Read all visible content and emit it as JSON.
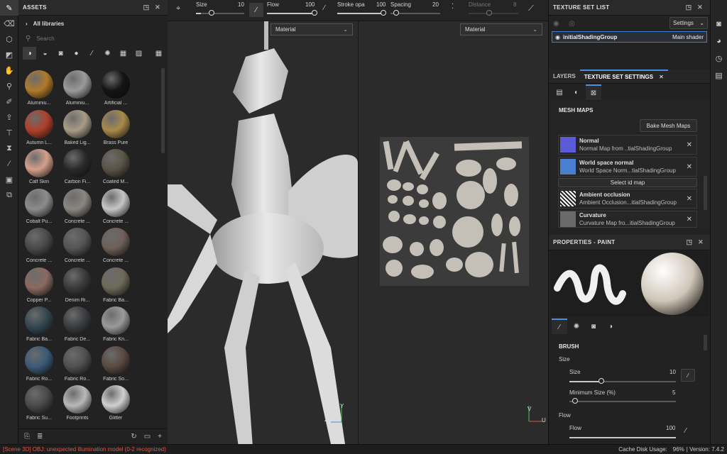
{
  "tools": {
    "items": [
      "brush-icon",
      "eraser-icon",
      "projection-icon",
      "polygon-fill-icon",
      "smudge-icon",
      "clone-icon",
      "color-picker-icon",
      "bake-icon",
      "text-icon",
      "geometry-mask-icon",
      "eyedropper-icon",
      "screenshot-icon",
      "layers-3d-icon"
    ]
  },
  "assets": {
    "title": "ASSETS",
    "library": "All libraries",
    "search_placeholder": "Search",
    "materials": [
      {
        "name": "Aluminiu...",
        "color": "#b07a2a"
      },
      {
        "name": "Aluminiu...",
        "color": "#9a9a9a"
      },
      {
        "name": "Artificial ...",
        "color": "#141414"
      },
      {
        "name": "Autumn L...",
        "color": "#b0402a"
      },
      {
        "name": "Baked Lig...",
        "color": "#a89c88"
      },
      {
        "name": "Brass Pure",
        "color": "#a88a4a"
      },
      {
        "name": "Calf Skin",
        "color": "#d4a08a"
      },
      {
        "name": "Carbon Fi...",
        "color": "#2a2a2a"
      },
      {
        "name": "Coated M...",
        "color": "#5a5446"
      },
      {
        "name": "Cobalt Pu...",
        "color": "#8c8c8c"
      },
      {
        "name": "Concrete ...",
        "color": "#8a8680"
      },
      {
        "name": "Concrete ...",
        "color": "#c6c6c6"
      },
      {
        "name": "Concrete ...",
        "color": "#4a4a4a"
      },
      {
        "name": "Concrete ...",
        "color": "#555555"
      },
      {
        "name": "Concrete ...",
        "color": "#6e6058"
      },
      {
        "name": "Copper P...",
        "color": "#8a6a60"
      },
      {
        "name": "Denim Ri...",
        "color": "#3a3a3a"
      },
      {
        "name": "Fabric Ba...",
        "color": "#6e6a5a"
      },
      {
        "name": "Fabric Ba...",
        "color": "#344650"
      },
      {
        "name": "Fabric De...",
        "color": "#3a3c40"
      },
      {
        "name": "Fabric Kn...",
        "color": "#9a9a9a"
      },
      {
        "name": "Fabric Ro...",
        "color": "#3c5a78"
      },
      {
        "name": "Fabric Ro...",
        "color": "#505050"
      },
      {
        "name": "Fabric So...",
        "color": "#5a4a42"
      },
      {
        "name": "Fabric Su...",
        "color": "#4a4a4a"
      },
      {
        "name": "Footprints",
        "color": "#b8b8b8"
      },
      {
        "name": "Glitter",
        "color": "#d0d0d0"
      }
    ]
  },
  "toolbar": {
    "size_label": "Size",
    "size_value": "10",
    "size_frac": 0.1,
    "flow_label": "Flow",
    "flow_value": "100",
    "flow_frac": 1.0,
    "stroke_label": "Stroke opa",
    "stroke_value": "100",
    "stroke_frac": 1.0,
    "spacing_label": "Spacing",
    "spacing_value": "20",
    "spacing_frac": 0.05,
    "distance_label": "Distance",
    "distance_value": "8"
  },
  "viewport": {
    "left_mode": "Material",
    "right_mode": "Material",
    "axis_z": "Z",
    "axis_y": "Y",
    "axis_x": "X",
    "axis_u": "U",
    "axis_v": "V"
  },
  "texture_set_list": {
    "title": "TEXTURE SET LIST",
    "settings": "Settings",
    "set_name": "initialShadingGroup",
    "shader": "Main shader"
  },
  "tabs": {
    "layers": "LAYERS",
    "tss": "TEXTURE SET SETTINGS"
  },
  "mesh_maps": {
    "title": "MESH MAPS",
    "bake": "Bake Mesh Maps",
    "select_id": "Select id map",
    "items": [
      {
        "name": "Normal",
        "sub": "Normal Map from ..tialShadingGroup"
      },
      {
        "name": "World space normal",
        "sub": "World Space Norm...tialShadingGroup"
      },
      {
        "name": "Ambient occlusion",
        "sub": "Ambient Occlusion...itialShadingGroup"
      },
      {
        "name": "Curvature",
        "sub": "Curvature Map fro...itialShadingGroup"
      }
    ]
  },
  "properties": {
    "title": "PROPERTIES - PAINT",
    "brush": "BRUSH",
    "size_group": "Size",
    "size_label": "Size",
    "size_value": "10",
    "size_frac": 0.3,
    "min_size_label": "Minimum Size (%)",
    "min_size_value": "5",
    "min_size_frac": 0.05,
    "flow_group": "Flow",
    "flow_label": "Flow",
    "flow_value": "100",
    "flow_frac": 1.0
  },
  "status": {
    "message": "[Scene 3D] OBJ: unexpected illumination model (0-2 recognized)",
    "cache": "Cache Disk Usage:",
    "cache_value": "96%",
    "version": "| Version: 7.4.2"
  }
}
